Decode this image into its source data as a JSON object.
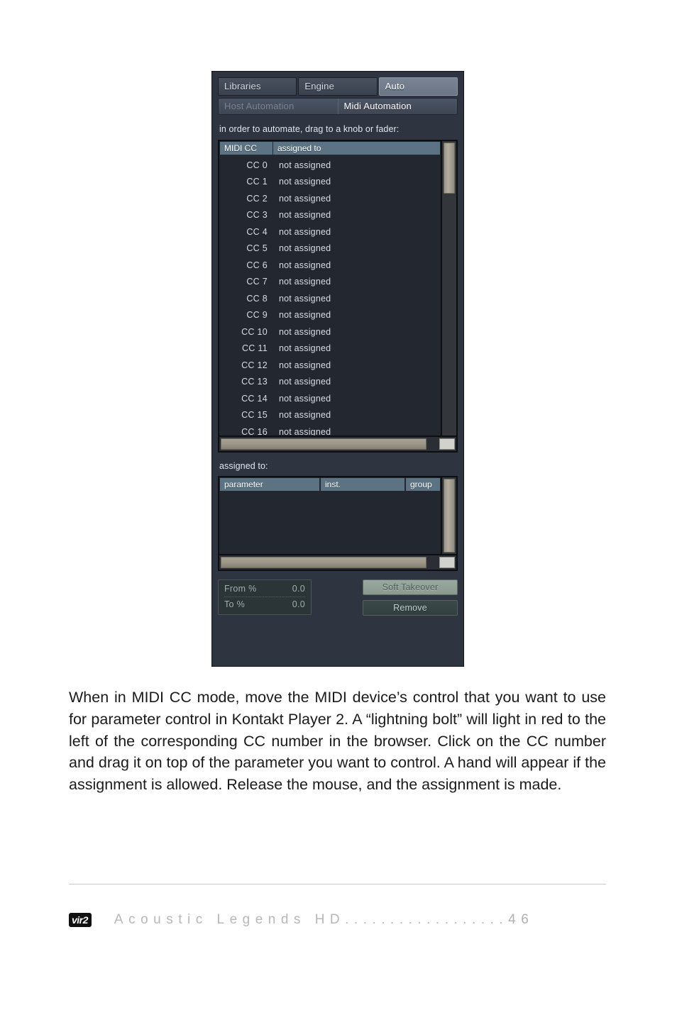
{
  "panel": {
    "tabs_top": [
      {
        "label": "Libraries",
        "active": false
      },
      {
        "label": "Engine",
        "active": false
      },
      {
        "label": "Auto",
        "active": true
      }
    ],
    "tabs_sub": [
      {
        "label": "Host Automation",
        "active": false
      },
      {
        "label": "Midi Automation",
        "active": true
      }
    ],
    "hint": "in order to automate, drag to a knob or fader:",
    "cc_table": {
      "columns": [
        "MIDI CC",
        "assigned to"
      ],
      "rows": [
        {
          "cc": "CC 0",
          "assigned": "not assigned"
        },
        {
          "cc": "CC 1",
          "assigned": "not assigned"
        },
        {
          "cc": "CC 2",
          "assigned": "not assigned"
        },
        {
          "cc": "CC 3",
          "assigned": "not assigned"
        },
        {
          "cc": "CC 4",
          "assigned": "not assigned"
        },
        {
          "cc": "CC 5",
          "assigned": "not assigned"
        },
        {
          "cc": "CC 6",
          "assigned": "not assigned"
        },
        {
          "cc": "CC 7",
          "assigned": "not assigned"
        },
        {
          "cc": "CC 8",
          "assigned": "not assigned"
        },
        {
          "cc": "CC 9",
          "assigned": "not assigned"
        },
        {
          "cc": "CC 10",
          "assigned": "not assigned"
        },
        {
          "cc": "CC 11",
          "assigned": "not assigned"
        },
        {
          "cc": "CC 12",
          "assigned": "not assigned"
        },
        {
          "cc": "CC 13",
          "assigned": "not assigned"
        },
        {
          "cc": "CC 14",
          "assigned": "not assigned"
        },
        {
          "cc": "CC 15",
          "assigned": "not assigned"
        },
        {
          "cc": "CC 16",
          "assigned": "not assigned"
        }
      ]
    },
    "assigned_section": {
      "label": "assigned to:",
      "columns": [
        "parameter",
        "inst.",
        "group"
      ],
      "rows": []
    },
    "range": {
      "from_label": "From %",
      "from_value": "0.0",
      "to_label": "To %",
      "to_value": "0.0"
    },
    "buttons": {
      "soft_takeover": "Soft Takeover",
      "remove": "Remove"
    },
    "colors": {
      "panel_bg": "#2e3440",
      "list_bg": "#23272f",
      "header_blue": "#5c7384",
      "scroll_thumb": "#9c9789",
      "tab_active": "#6d7888"
    }
  },
  "body": {
    "paragraph": "When in MIDI CC mode, move the MIDI device’s control that you want to use for parameter control in Kontakt Player 2. A “lightning bolt” will light in red to the left of the corresponding CC number in the browser. Click on the CC number and drag it on top of the parameter you want to control. A hand will appear if the assignment is  allowed. Release the mouse, and the assignment is made."
  },
  "footer": {
    "logo": "vir2",
    "title": "Acoustic Legends HD",
    "leader": "..................",
    "page": "46"
  }
}
